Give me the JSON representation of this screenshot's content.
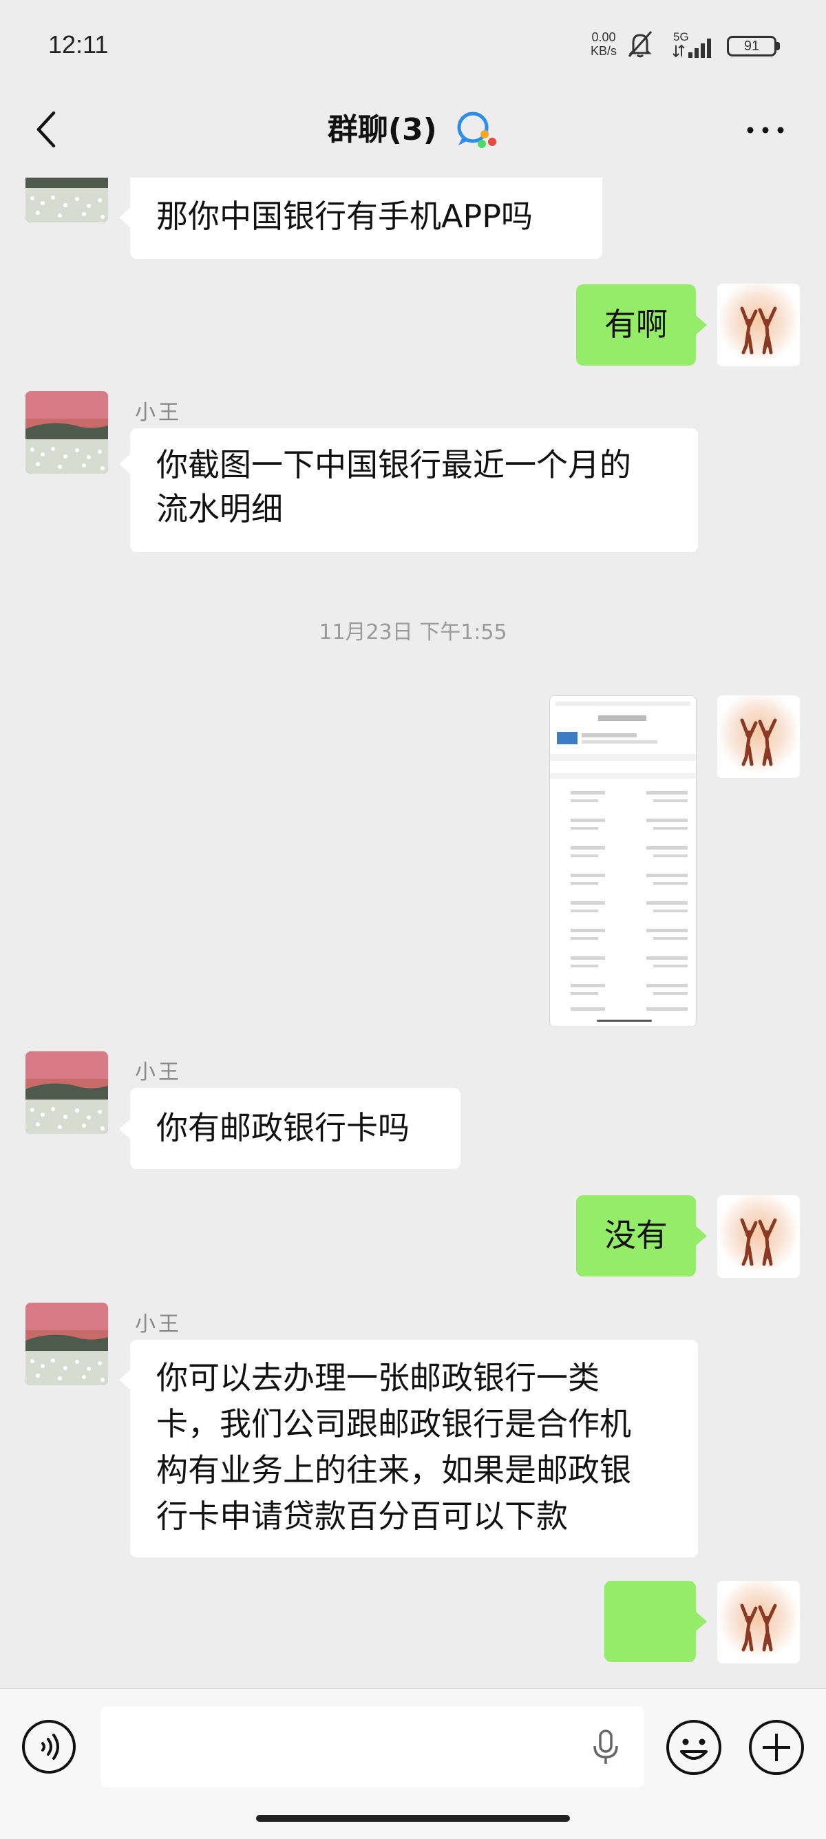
{
  "status_bar": {
    "time": "12:11",
    "net_speed_value": "0.00",
    "net_speed_unit": "KB/s",
    "signal_label": "5G",
    "battery": "91"
  },
  "header": {
    "title": "群聊(3)"
  },
  "messages": [
    {
      "text": "那你中国银行有手机APP吗"
    },
    {
      "text": "有啊"
    },
    {
      "sender": "小王",
      "text": "你截图一下中国银行最近一个月的\n流水明细"
    },
    {
      "timestamp": "11月23日 下午1:55"
    },
    {
      "type": "image"
    },
    {
      "sender": "小王",
      "text": "你有邮政银行卡吗"
    },
    {
      "text": "没有"
    },
    {
      "sender": "小王",
      "text": "你可以去办理一张邮政银行一类\n卡，我们公司跟邮政银行是合作机\n构有业务上的往来，如果是邮政银\n行卡申请贷款百分百可以下款"
    },
    {
      "emoji": "😓"
    }
  ],
  "colors": {
    "background": "#ededed",
    "outgoing_bubble": "#95ec69",
    "incoming_bubble": "#ffffff"
  }
}
